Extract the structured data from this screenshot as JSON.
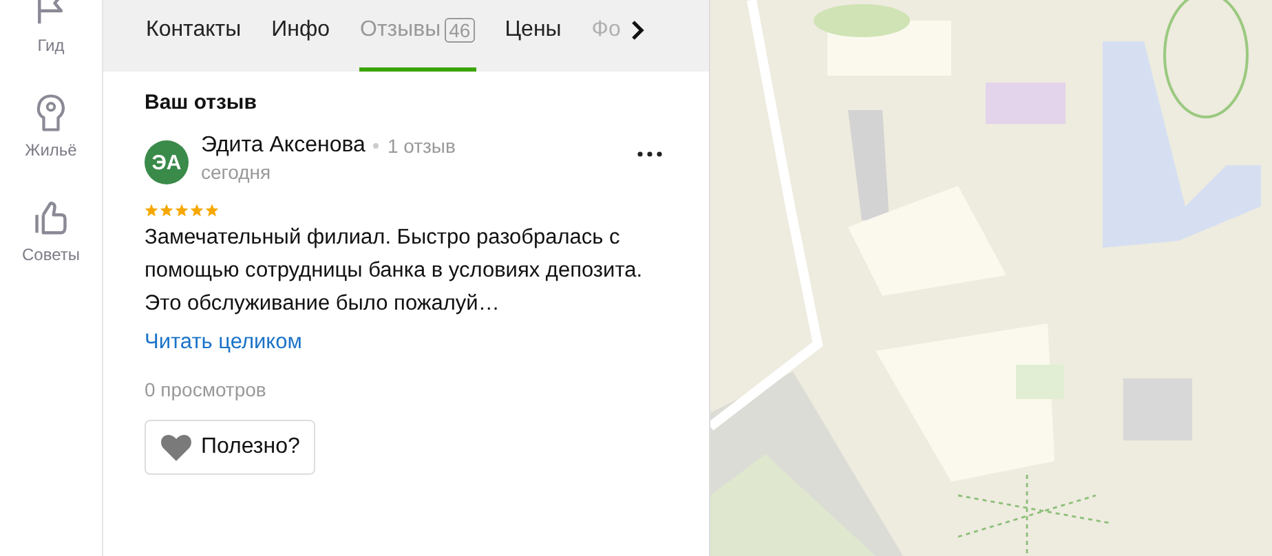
{
  "sidebar": {
    "items": [
      {
        "kind": "guide",
        "label": "Гид"
      },
      {
        "kind": "housing",
        "label": "Жильё"
      },
      {
        "kind": "tips",
        "label": "Советы"
      }
    ]
  },
  "tabs": [
    {
      "label": "Контакты",
      "selected": false,
      "faded": false
    },
    {
      "label": "Инфо",
      "selected": false,
      "faded": false
    },
    {
      "label": "Отзывы",
      "count": "46",
      "selected": true,
      "faded": false
    },
    {
      "label": "Цены",
      "selected": false,
      "faded": false
    },
    {
      "label": "Фо",
      "selected": false,
      "faded": true
    }
  ],
  "review": {
    "section_title": "Ваш отзыв",
    "avatar_initials": "ЭА",
    "author": "Эдита Аксенова",
    "author_reviews": "1 отзыв",
    "date": "сегодня",
    "stars": 5,
    "text": "Замечательный филиал. Быстро разобралась с помощью сотрудницы банка в условиях депозита. Это обслуживание было пожалуй…",
    "read_more": "Читать целиком",
    "views": "0 просмотров",
    "helpful_button": "Полезно?"
  }
}
